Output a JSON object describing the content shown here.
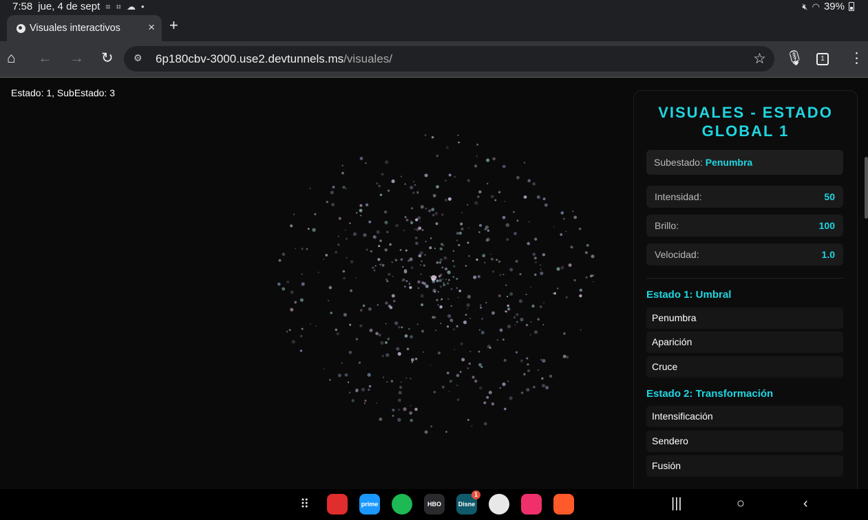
{
  "status_bar": {
    "time": "7:58",
    "date": "jue, 4 de sept",
    "battery": "39%"
  },
  "tab": {
    "title": "Visuales interactivos",
    "close": "×",
    "new_tab": "+"
  },
  "toolbar": {
    "url_host": "6p180cbv-3000.use2.devtunnels.ms",
    "url_path": "/visuales/",
    "tab_count": "1"
  },
  "page": {
    "state_label": "Estado: 1, SubEstado: 3"
  },
  "panel": {
    "title": "VISUALES - ESTADO GLOBAL 1",
    "substate_label": "Subestado:",
    "substate_value": "Penumbra",
    "params": [
      {
        "label": "Intensidad:",
        "value": "50"
      },
      {
        "label": "Brillo:",
        "value": "100"
      },
      {
        "label": "Velocidad:",
        "value": "1.0"
      }
    ],
    "groups": [
      {
        "title": "Estado 1: Umbral",
        "items": [
          "Penumbra",
          "Aparición",
          "Cruce"
        ]
      },
      {
        "title": "Estado 2: Transformación",
        "items": [
          "Intensificación",
          "Sendero",
          "Fusión"
        ]
      }
    ]
  },
  "nav_bar": {
    "apps": [
      {
        "name": "flipboard-icon",
        "color": "#e02d2d",
        "label": ""
      },
      {
        "name": "prime-video-icon",
        "color": "#1a98ff",
        "label": "prime video"
      },
      {
        "name": "spotify-icon",
        "color": "#1db954",
        "label": ""
      },
      {
        "name": "hbo-max-icon",
        "color": "#2a2a2e",
        "label": "HBO max"
      },
      {
        "name": "disney-plus-icon",
        "color": "#0f5a6b",
        "label": "Disney+",
        "badge": "1"
      },
      {
        "name": "chrome-icon",
        "color": "#e8e8e8",
        "label": ""
      },
      {
        "name": "screen-recorder-icon",
        "color": "#f0306a",
        "label": ""
      },
      {
        "name": "brave-icon",
        "color": "#ff5a2a",
        "label": ""
      }
    ]
  },
  "colors": {
    "accent": "#1fd6e0",
    "panel_bg": "#0c0c0d",
    "page_bg": "#0a0a0a"
  }
}
